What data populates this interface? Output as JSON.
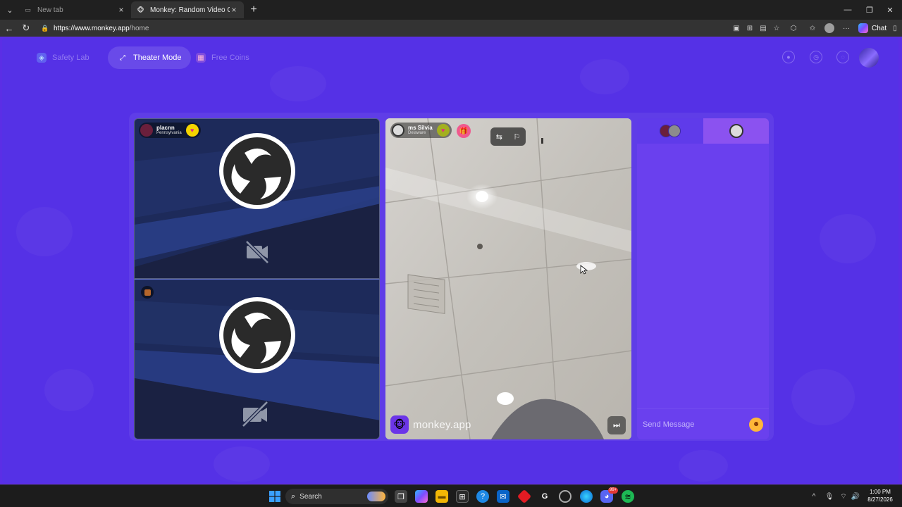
{
  "browser": {
    "tabs": [
      {
        "label": "New tab",
        "icon": "page-icon",
        "state": "inactive"
      },
      {
        "label": "Monkey: Random Video Chat",
        "icon": "monkey-favicon",
        "state": "active"
      }
    ],
    "url": {
      "host": "https://www.monkey.app",
      "path": "/home"
    },
    "copilot_label": "Chat"
  },
  "topnav": {
    "safety_lab": "Safety Lab",
    "theater_mode": "Theater Mode",
    "free_coins": "Free Coins",
    "right_icons": [
      "user-icon",
      "history-icon",
      "chat-bubble-icon",
      "profile-avatar"
    ]
  },
  "feeds": {
    "top": {
      "username": "placnn",
      "location": "Pennsylvania",
      "badge": "heart-badge",
      "camera": "camera-off-icon"
    },
    "bottom": {
      "camera": "camera-off-icon"
    }
  },
  "partner": {
    "username": "ms Silvia",
    "location": "Delaware",
    "watermark": "monkey.app",
    "controls": [
      "switch-icon",
      "report-icon"
    ]
  },
  "chat": {
    "placeholder": "Send Message"
  },
  "taskbar": {
    "search_label": "Search",
    "badge_count": "99+",
    "time": "1:00 PM",
    "date": "8/27/2026"
  },
  "colors": {
    "page_bg": "#5531e6",
    "chat_bg": "#6a40ee",
    "feed_bg": "#1e2a58",
    "heart_yellow": "#f5d400"
  }
}
